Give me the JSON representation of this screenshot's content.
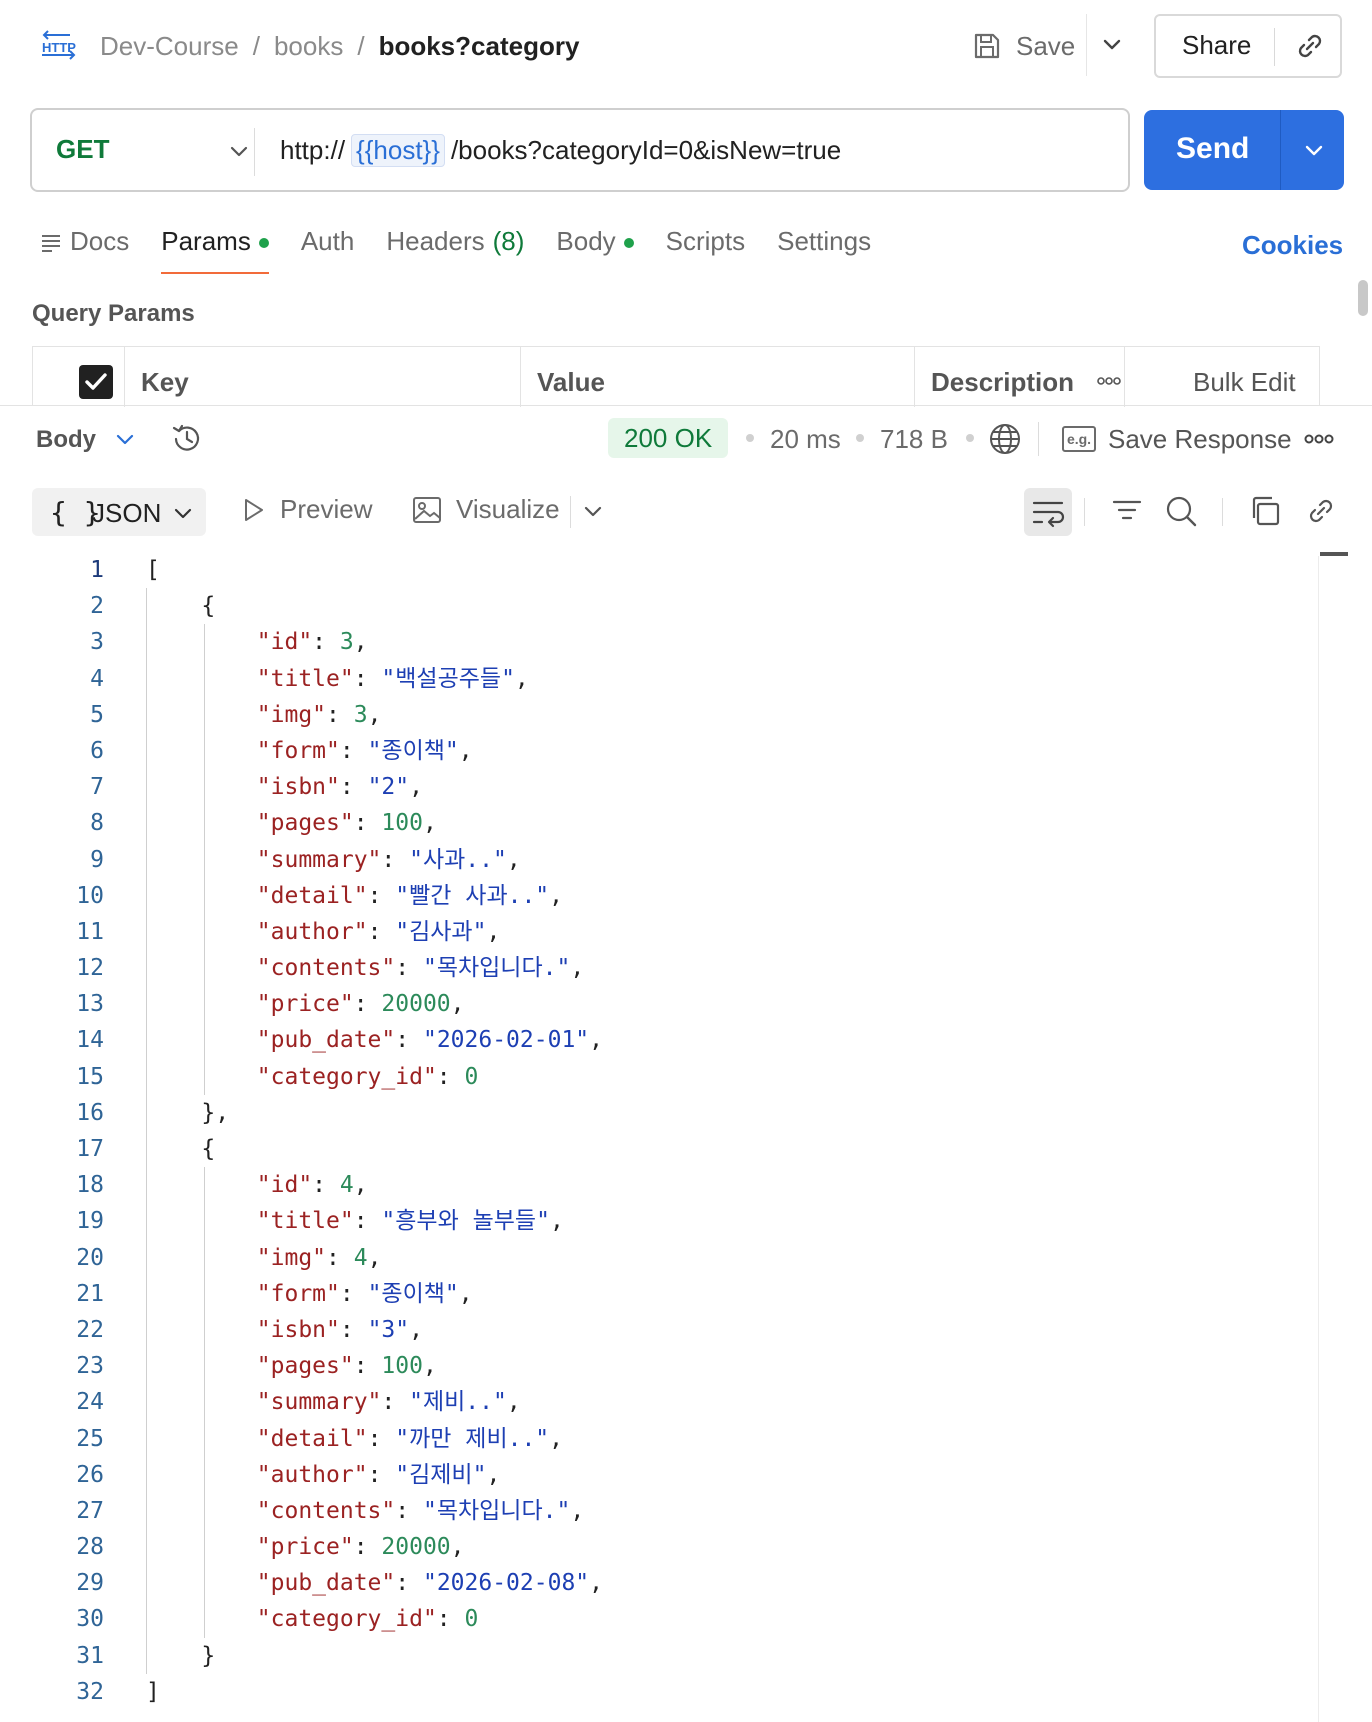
{
  "header": {
    "icon_label": "HTTP",
    "breadcrumb": [
      "Dev-Course",
      "books",
      "books?category"
    ],
    "save_label": "Save",
    "share_label": "Share"
  },
  "request": {
    "method": "GET",
    "url_prefix": "http://",
    "url_variable": "{{host}}",
    "url_path": "/books?categoryId=0&isNew=true",
    "send_label": "Send"
  },
  "tabs": [
    {
      "label": "Docs"
    },
    {
      "label": "Params",
      "active": true,
      "dot": true
    },
    {
      "label": "Auth"
    },
    {
      "label": "Headers",
      "count": "(8)"
    },
    {
      "label": "Body",
      "dot": true
    },
    {
      "label": "Scripts"
    },
    {
      "label": "Settings"
    }
  ],
  "cookies_label": "Cookies",
  "query_params": {
    "title": "Query Params",
    "columns": [
      "Key",
      "Value",
      "Description"
    ],
    "bulk_edit": "Bulk Edit"
  },
  "response": {
    "section_label": "Body",
    "status": "200 OK",
    "time": "20 ms",
    "size": "718 B",
    "eg_label": "e.g.",
    "save_response": "Save Response",
    "format": "JSON",
    "format_braces": "{ }",
    "preview_label": "Preview",
    "visualize_label": "Visualize"
  },
  "colors": {
    "send_button": "#2d6fe0",
    "method_get": "#0f7a3a",
    "status_ok_bg": "#e6f6ea",
    "active_tab_underline": "#f26b3a",
    "json_key": "#9b2222",
    "json_string": "#1d3fb3",
    "json_number": "#2c8a5a"
  },
  "books": [
    {
      "id": 3,
      "title": "백설공주들",
      "img": 3,
      "form": "종이책",
      "isbn": "2",
      "pages": 100,
      "summary": "사과..",
      "detail": "빨간 사과..",
      "author": "김사과",
      "contents": "목차입니다.",
      "price": 20000,
      "pub_date": "2026-02-01",
      "category_id": 0
    },
    {
      "id": 4,
      "title": "흥부와 놀부들",
      "img": 4,
      "form": "종이책",
      "isbn": "3",
      "pages": 100,
      "summary": "제비..",
      "detail": "까만 제비..",
      "author": "김제비",
      "contents": "목차입니다.",
      "price": 20000,
      "pub_date": "2026-02-08",
      "category_id": 0
    }
  ]
}
